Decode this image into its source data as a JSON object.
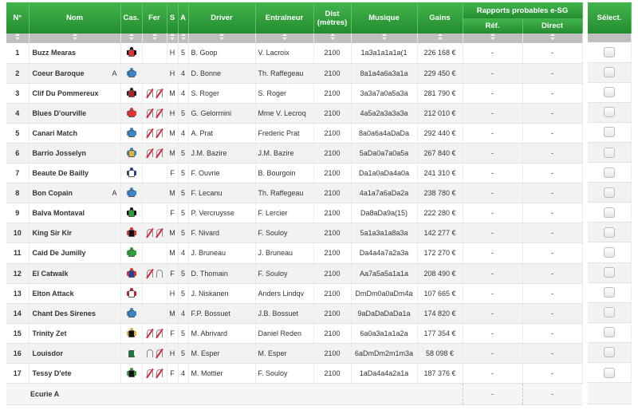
{
  "headers": {
    "num": "N°",
    "nom": "Nom",
    "cas": "Cas.",
    "fer": "Fer",
    "s": "S",
    "a": "A",
    "driver": "Driver",
    "entraineur": "Entraîneur",
    "dist": "Dist (mètres)",
    "musique": "Musique",
    "gains": "Gains",
    "rapports": "Rapports probables e-SG",
    "ref": "Réf.",
    "direct": "Direct",
    "select": "Sélect."
  },
  "rows": [
    {
      "num": "1",
      "nom": "Buzz Mearas",
      "mark": "",
      "cas_colors": [
        "#e4312d",
        "#111111"
      ],
      "fer": "",
      "s": "H",
      "a": "5",
      "driver": "B. Goop",
      "entraineur": "V. Lacroix",
      "dist": "2100",
      "musique": "1a3a1a1a1a(1",
      "gains": "226 168 €",
      "ref": "-",
      "direct": "-"
    },
    {
      "num": "2",
      "nom": "Coeur Baroque",
      "mark": "A",
      "cas_colors": [
        "#3b86c8",
        "#3b86c8"
      ],
      "fer": "",
      "s": "H",
      "a": "4",
      "driver": "D. Bonne",
      "entraineur": "Th. Raffegeau",
      "dist": "2100",
      "musique": "8a1a4a6a3a1a",
      "gains": "229 450 €",
      "ref": "-",
      "direct": "-"
    },
    {
      "num": "3",
      "nom": "Clif Du Pommereux",
      "mark": "",
      "cas_colors": [
        "#b3202a",
        "#222222"
      ],
      "fer": "D4",
      "s": "M",
      "a": "4",
      "driver": "S. Roger",
      "entraineur": "S. Roger",
      "dist": "2100",
      "musique": "3a3a7a0a5a3a",
      "gains": "281 790 €",
      "ref": "-",
      "direct": "-"
    },
    {
      "num": "4",
      "nom": "Blues D'ourville",
      "mark": "",
      "cas_colors": [
        "#e4312d",
        "#e4312d"
      ],
      "fer": "D4",
      "s": "H",
      "a": "5",
      "driver": "G. Gelormini",
      "entraineur": "Mme V. Lecroq",
      "dist": "2100",
      "musique": "4a5a2a3a3a3a",
      "gains": "212 010 €",
      "ref": "-",
      "direct": "-"
    },
    {
      "num": "5",
      "nom": "Canari Match",
      "mark": "",
      "cas_colors": [
        "#3b86c8",
        "#3b86c8"
      ],
      "fer": "D4",
      "s": "M",
      "a": "4",
      "driver": "A. Prat",
      "entraineur": "Frederic Prat",
      "dist": "2100",
      "musique": "8a0a6a4aDaDa",
      "gains": "292 440 €",
      "ref": "-",
      "direct": "-"
    },
    {
      "num": "6",
      "nom": "Barrio Josselyn",
      "mark": "",
      "cas_colors": [
        "#e2b23a",
        "#3b86c8"
      ],
      "fer": "D4",
      "s": "M",
      "a": "5",
      "driver": "J.M. Bazire",
      "entraineur": "J.M. Bazire",
      "dist": "2100",
      "musique": "5aDa0a7a0a5a",
      "gains": "267 840 €",
      "ref": "-",
      "direct": "-"
    },
    {
      "num": "7",
      "nom": "Beaute De Bailly",
      "mark": "",
      "cas_colors": [
        "#ffffff",
        "#2a3f9a"
      ],
      "fer": "",
      "s": "F",
      "a": "5",
      "driver": "F. Ouvrie",
      "entraineur": "B. Bourgoin",
      "dist": "2100",
      "musique": "Da1a0aDa4a0a",
      "gains": "241 310 €",
      "ref": "-",
      "direct": "-"
    },
    {
      "num": "8",
      "nom": "Bon Copain",
      "mark": "A",
      "cas_colors": [
        "#3b86c8",
        "#3b86c8"
      ],
      "fer": "",
      "s": "M",
      "a": "5",
      "driver": "F. Lecanu",
      "entraineur": "Th. Raffegeau",
      "dist": "2100",
      "musique": "4a1a7a6aDa2a",
      "gains": "238 780 €",
      "ref": "-",
      "direct": "-"
    },
    {
      "num": "9",
      "nom": "Balva Montaval",
      "mark": "",
      "cas_colors": [
        "#2aa13a",
        "#111111"
      ],
      "fer": "",
      "s": "F",
      "a": "5",
      "driver": "P. Vercruysse",
      "entraineur": "F. Lercier",
      "dist": "2100",
      "musique": "Da8aDa9a(15)",
      "gains": "222 280 €",
      "ref": "-",
      "direct": "-"
    },
    {
      "num": "10",
      "nom": "King Sir Kir",
      "mark": "",
      "cas_colors": [
        "#111111",
        "#e4312d"
      ],
      "fer": "D4",
      "s": "M",
      "a": "5",
      "driver": "F. Nivard",
      "entraineur": "F. Souloy",
      "dist": "2100",
      "musique": "5a1a3a1a8a3a",
      "gains": "142 277 €",
      "ref": "-",
      "direct": "-"
    },
    {
      "num": "11",
      "nom": "Caid De Jumilly",
      "mark": "",
      "cas_colors": [
        "#2aa13a",
        "#2aa13a"
      ],
      "fer": "",
      "s": "M",
      "a": "4",
      "driver": "J. Bruneau",
      "entraineur": "J. Bruneau",
      "dist": "2100",
      "musique": "Da4a4a7a2a3a",
      "gains": "172 270 €",
      "ref": "-",
      "direct": "-"
    },
    {
      "num": "12",
      "nom": "El Catwalk",
      "mark": "",
      "cas_colors": [
        "#2a3f9a",
        "#e4312d"
      ],
      "fer": "DP",
      "s": "F",
      "a": "5",
      "driver": "D. Thomain",
      "entraineur": "F. Souloy",
      "dist": "2100",
      "musique": "Aa7a5a5a1a1a",
      "gains": "208 490 €",
      "ref": "-",
      "direct": "-"
    },
    {
      "num": "13",
      "nom": "Elton Attack",
      "mark": "",
      "cas_colors": [
        "#ffffff",
        "#c3202e"
      ],
      "fer": "",
      "s": "H",
      "a": "5",
      "driver": "J. Niskanen",
      "entraineur": "Anders Lindqv",
      "dist": "2100",
      "musique": "DmDm0a0aDm4a",
      "gains": "107 665 €",
      "ref": "-",
      "direct": "-"
    },
    {
      "num": "14",
      "nom": "Chant Des Sirenes",
      "mark": "",
      "cas_colors": [
        "#3b86c8",
        "#3b86c8"
      ],
      "fer": "",
      "s": "M",
      "a": "4",
      "driver": "F.P. Bossuet",
      "entraineur": "J.B. Bossuet",
      "dist": "2100",
      "musique": "9aDaDaDaDa1a",
      "gains": "174 820 €",
      "ref": "-",
      "direct": "-"
    },
    {
      "num": "15",
      "nom": "Trinity Zet",
      "mark": "",
      "cas_colors": [
        "#111111",
        "#e2b23a"
      ],
      "fer": "D4",
      "s": "F",
      "a": "5",
      "driver": "M. Abrivard",
      "entraineur": "Daniel Reden",
      "dist": "2100",
      "musique": "6a0a3a1a1a2a",
      "gains": "177 354 €",
      "ref": "-",
      "direct": "-"
    },
    {
      "num": "16",
      "nom": "Louisdor",
      "mark": "",
      "cas_colors": [
        "#1d7a3a",
        "#ffffff"
      ],
      "fer": "PA",
      "s": "H",
      "a": "5",
      "driver": "M. Esper",
      "entraineur": "M. Esper",
      "dist": "2100",
      "musique": "6aDmDm2m1m3a",
      "gains": "58 098 €",
      "ref": "-",
      "direct": "-"
    },
    {
      "num": "17",
      "nom": "Tessy D'ete",
      "mark": "",
      "cas_colors": [
        "#111111",
        "#2aa13a"
      ],
      "fer": "D4",
      "s": "F",
      "a": "4",
      "driver": "M. Mottier",
      "entraineur": "F. Souloy",
      "dist": "2100",
      "musique": "1aDa4a4a2a1a",
      "gains": "187 376 €",
      "ref": "-",
      "direct": "-"
    }
  ],
  "ecurie": {
    "label": "Ecurie A",
    "ref": "-",
    "direct": "-"
  }
}
